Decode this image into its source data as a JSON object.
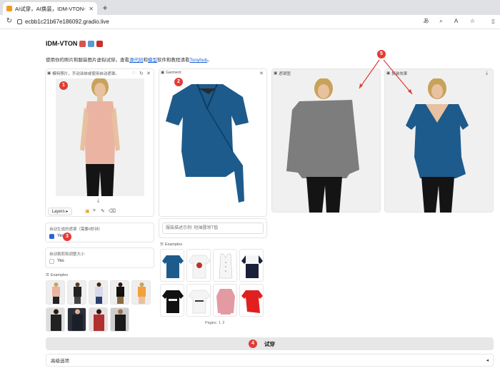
{
  "browser": {
    "tab_title": "AI试穿，AI换装，IDM-VTON-Tom",
    "url": "ecbb1c21b67e186092.gradio.live"
  },
  "app": {
    "title": "IDM-VTON",
    "description_prefix": "使用你的照片和服装图片虚拟试穿。查看",
    "link_code": "源代码",
    "description_mid1": "和",
    "link_model": "模型",
    "description_mid2": "软件和教程请看",
    "link_hub": "Tonyhub",
    "description_suffix": "。"
  },
  "human_panel": {
    "label": "模特照片，手动涂抹或使用自动遮罩。",
    "layers_label": "Layers"
  },
  "garment_panel": {
    "label": "Garment"
  },
  "mask_panel": {
    "label": "遮罩图"
  },
  "output_panel": {
    "label": "换装效果"
  },
  "auto_mask": {
    "label": "自动生成的遮罩（需要4秒钟）",
    "option": "Yes",
    "checked": true
  },
  "auto_crop": {
    "label": "自动裁剪和调整大小",
    "option": "Yes",
    "checked": false
  },
  "garment_description": {
    "placeholder": "服装描述示例: 短袖圆领T恤"
  },
  "human_examples": {
    "label": "Examples"
  },
  "garment_examples": {
    "label": "Examples",
    "pages_label": "Pages:",
    "page_1": "1",
    "page_2": "2"
  },
  "tryon_button": {
    "label": "试穿"
  },
  "advanced": {
    "label": "高级选项"
  },
  "markers": {
    "m1": "1",
    "m2": "2",
    "m3": "3",
    "m4": "4",
    "m5": "5"
  },
  "colors": {
    "marker": "#e33b35",
    "garment_blue": "#1d5b8c",
    "mask_gray": "#7d7d7d",
    "link": "#1a5fd6"
  }
}
